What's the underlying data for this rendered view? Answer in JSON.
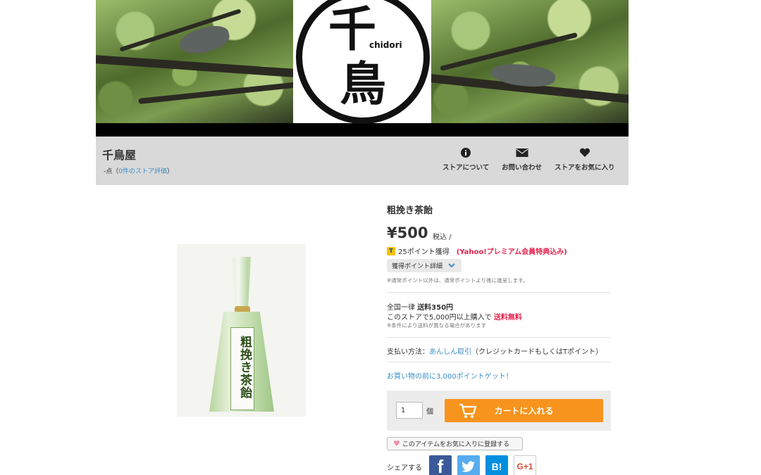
{
  "banner": {
    "logo_char_top": "千",
    "logo_char_bottom": "鳥",
    "logo_romaji": "chidori"
  },
  "store": {
    "name": "千鳥屋",
    "rating_prefix": "-点（",
    "rating_link": "0件のストア評価",
    "rating_suffix": "）",
    "nav": [
      {
        "label": "ストアについて",
        "icon": "info-icon"
      },
      {
        "label": "お問い合わせ",
        "icon": "mail-icon"
      },
      {
        "label": "ストアをお気に入り",
        "icon": "heart-icon"
      }
    ]
  },
  "product": {
    "title": "粗挽き茶飴",
    "price": "¥500",
    "tax": "税込 /",
    "points_text": "25ポイント獲得",
    "points_premium": "(Yahoo!プレミアム会員特典込み)",
    "points_detail_label": "獲得ポイント詳細",
    "points_note": "※通常ポイント以外は、通常ポイントより後に進呈します。",
    "package_text": "粗挽き茶飴"
  },
  "shipping": {
    "line1_prefix": "全国一律",
    "line1_bold": "送料350円",
    "line2_prefix": "このストアで5,000円以上購入で",
    "line2_free": "送料無料",
    "note": "※条件により送料が異なる場合があります"
  },
  "payment": {
    "label": "支払い方法：",
    "link": "あんしん取引",
    "suffix": "（クレジットカードもしくはTポイント）"
  },
  "promo": {
    "text": "お買い物の前に3,000ポイントゲット！"
  },
  "cart": {
    "quantity": "1",
    "unit": "個",
    "button_label": "カートに入れる"
  },
  "favorite": {
    "label": "このアイテムをお気に入りに登録する"
  },
  "share": {
    "label": "シェアする",
    "facebook": "f",
    "hatena": "B!",
    "googleplus": "G+1"
  },
  "colors": {
    "accent_orange": "#f7941d",
    "link_blue": "#3a8fc7",
    "sale_red": "#e3224c"
  }
}
